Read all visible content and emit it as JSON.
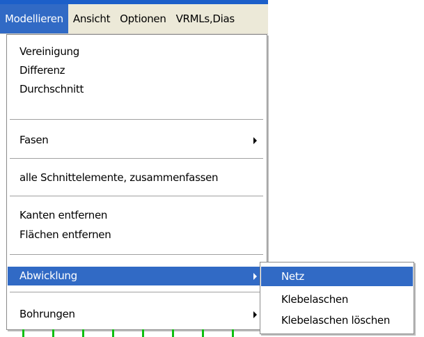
{
  "menubar": {
    "items": [
      "Modellieren",
      "Ansicht",
      "Optionen",
      "VRMLs,Dias"
    ]
  },
  "menu": {
    "vereinigung": "Vereinigung",
    "differenz": "Differenz",
    "durchschnitt": "Durchschnitt",
    "fasen": "Fasen",
    "alle_schnittelemente": "alle Schnittelemente, zusammenfassen",
    "kanten_entfernen": "Kanten entfernen",
    "flaechen_entfernen": "Flächen entfernen",
    "abwicklung": "Abwicklung",
    "bohrungen": "Bohrungen"
  },
  "submenu": {
    "netz": "Netz",
    "klebelaschen": "Klebelaschen",
    "klebelaschen_loeschen": "Klebelaschen löschen"
  },
  "colors": {
    "highlight": "#316ac5",
    "menubar_bg": "#ece9d8",
    "title_strip": "#1c5fc9",
    "grid_marks": "#10c010"
  }
}
